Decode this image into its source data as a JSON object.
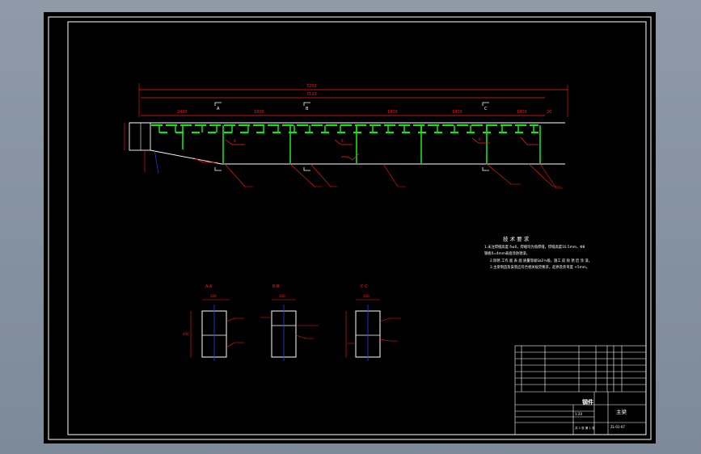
{
  "drawing": {
    "background": "#000000",
    "frame_color": "#ffffff",
    "dimension_color": "#ff1a1a",
    "beam_color": "#19e019",
    "centerline_color": "#2a3cff"
  },
  "elevation": {
    "overall_dim": "7200",
    "inner_dim": "7120",
    "segment_dims": [
      "2400",
      "1800",
      "1800",
      "1800",
      "1800",
      "20"
    ],
    "section_marks": [
      "A",
      "B",
      "C"
    ],
    "weld_tag": "6"
  },
  "notes": {
    "title": "技 术 要 求",
    "lines": [
      "1.未注焊缝高度 δ≤6，焊缝均为角焊缝，焊缝高度10.5mm，Φ8",
      "钢板δ=4mm表面涂防锈漆。",
      "2.除锈 工作 面 表 面 质量等级Sa2½级，施工 前 除 锈 后 涂 漆。",
      "3.主梁制造及安装应符合相关规范要求，起拱及旁弯度 +5mm。"
    ]
  },
  "sections": [
    {
      "label": "A-A",
      "width": "300",
      "height": "400"
    },
    {
      "label": "B-B",
      "width": "300",
      "height": "400"
    },
    {
      "label": "C-C",
      "width": "300",
      "height": "400"
    }
  ],
  "title_block": {
    "part_name": "钢件",
    "drawing_name": "主梁",
    "drawing_no": "ZL-01-07",
    "scale": "1:20",
    "sheet": "共 1 张  第 1 张"
  }
}
